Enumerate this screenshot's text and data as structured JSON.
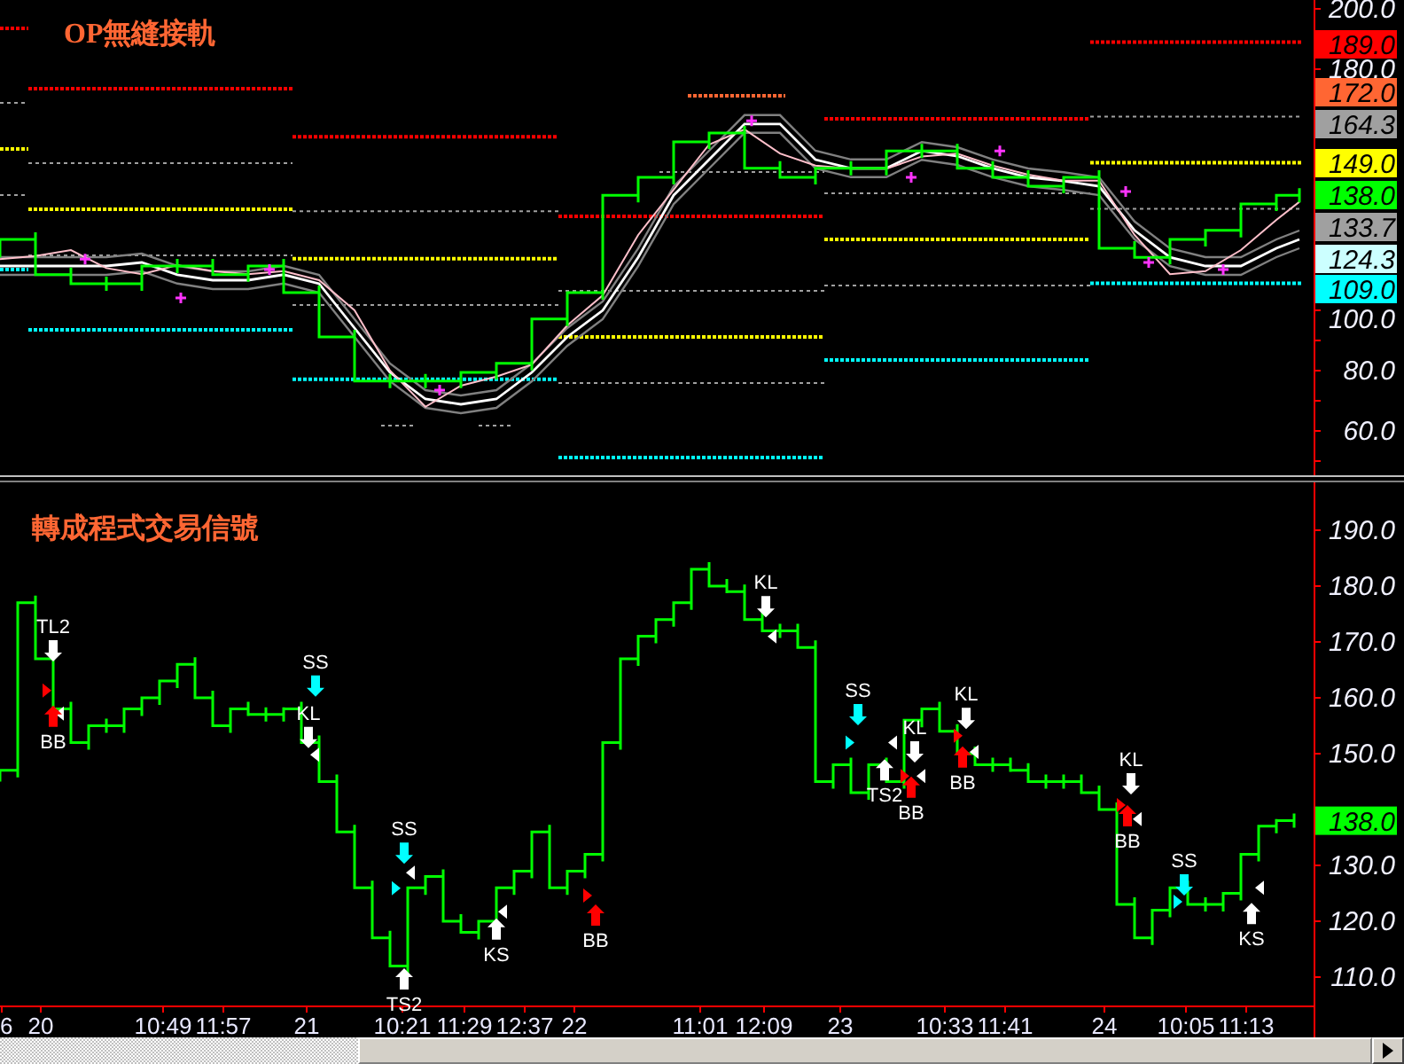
{
  "upper_panel": {
    "title": "OP無縫接軌",
    "axis_labels": [
      "200.0",
      "180.0",
      "100.0",
      "80.0",
      "60.0"
    ],
    "price_tags": [
      {
        "label": "189.0",
        "color": "#ff0000"
      },
      {
        "label": "172.0",
        "color": "#ff6633"
      },
      {
        "label": "164.3",
        "color": "#a0a0a0"
      },
      {
        "label": "149.0",
        "color": "#ffff00"
      },
      {
        "label": "138.0",
        "color": "#00ff00"
      },
      {
        "label": "133.7",
        "color": "#a0a0a0"
      },
      {
        "label": "124.3",
        "color": "#ccffff"
      },
      {
        "label": "109.0",
        "color": "#00ffff"
      }
    ]
  },
  "lower_panel": {
    "title": "轉成程式交易信號",
    "axis_labels": [
      "190.0",
      "180.0",
      "170.0",
      "160.0",
      "150.0",
      "130.0",
      "120.0",
      "110.0"
    ],
    "price_tags": [
      {
        "label": "138.0",
        "color": "#00ff00"
      }
    ],
    "time_labels": [
      "6",
      "20",
      "10:49",
      "11:57",
      "21",
      "10:21",
      "11:29",
      "12:37",
      "22",
      "11:01",
      "12:09",
      "23",
      "10:33",
      "11:41",
      "24",
      "10:05",
      "11:13"
    ],
    "signals": [
      {
        "label": "TL2",
        "kind": "down",
        "color": "#ffffff"
      },
      {
        "label": "BB",
        "kind": "up",
        "color": "#ff0000"
      },
      {
        "label": "SS",
        "kind": "down",
        "color": "#00ffff"
      },
      {
        "label": "KL",
        "kind": "down",
        "color": "#ffffff"
      },
      {
        "label": "SS",
        "kind": "down",
        "color": "#00ffff"
      },
      {
        "label": "TS2",
        "kind": "up",
        "color": "#ffffff"
      },
      {
        "label": "KS",
        "kind": "up",
        "color": "#ffffff"
      },
      {
        "label": "BB",
        "kind": "up",
        "color": "#ff0000"
      },
      {
        "label": "KL",
        "kind": "down",
        "color": "#ffffff"
      },
      {
        "label": "SS",
        "kind": "down",
        "color": "#00ffff"
      },
      {
        "label": "TS2",
        "kind": "up",
        "color": "#ffffff"
      },
      {
        "label": "KL",
        "kind": "down",
        "color": "#ffffff"
      },
      {
        "label": "BB",
        "kind": "up",
        "color": "#ff0000"
      },
      {
        "label": "KL",
        "kind": "down",
        "color": "#ffffff"
      },
      {
        "label": "BB",
        "kind": "up",
        "color": "#ff0000"
      },
      {
        "label": "KL",
        "kind": "down",
        "color": "#ffffff"
      },
      {
        "label": "BB",
        "kind": "up",
        "color": "#ff0000"
      },
      {
        "label": "SS",
        "kind": "down",
        "color": "#00ffff"
      },
      {
        "label": "KS",
        "kind": "up",
        "color": "#ffffff"
      }
    ],
    "markers": [
      {
        "kind": "right",
        "color": "#ff0000"
      },
      {
        "kind": "left",
        "color": "#ffffff"
      },
      {
        "kind": "left",
        "color": "#ffffff"
      },
      {
        "kind": "left",
        "color": "#ffffff"
      },
      {
        "kind": "right",
        "color": "#00ffff"
      },
      {
        "kind": "left",
        "color": "#ffffff"
      },
      {
        "kind": "right",
        "color": "#ff0000"
      },
      {
        "kind": "left",
        "color": "#ffffff"
      },
      {
        "kind": "right",
        "color": "#00ffff"
      },
      {
        "kind": "left",
        "color": "#ffffff"
      },
      {
        "kind": "right",
        "color": "#ff0000"
      },
      {
        "kind": "left",
        "color": "#ffffff"
      },
      {
        "kind": "right",
        "color": "#ff0000"
      },
      {
        "kind": "left",
        "color": "#ffffff"
      },
      {
        "kind": "right",
        "color": "#ff0000"
      },
      {
        "kind": "left",
        "color": "#ffffff"
      },
      {
        "kind": "right",
        "color": "#00ffff"
      },
      {
        "kind": "left",
        "color": "#ffffff"
      }
    ]
  }
}
